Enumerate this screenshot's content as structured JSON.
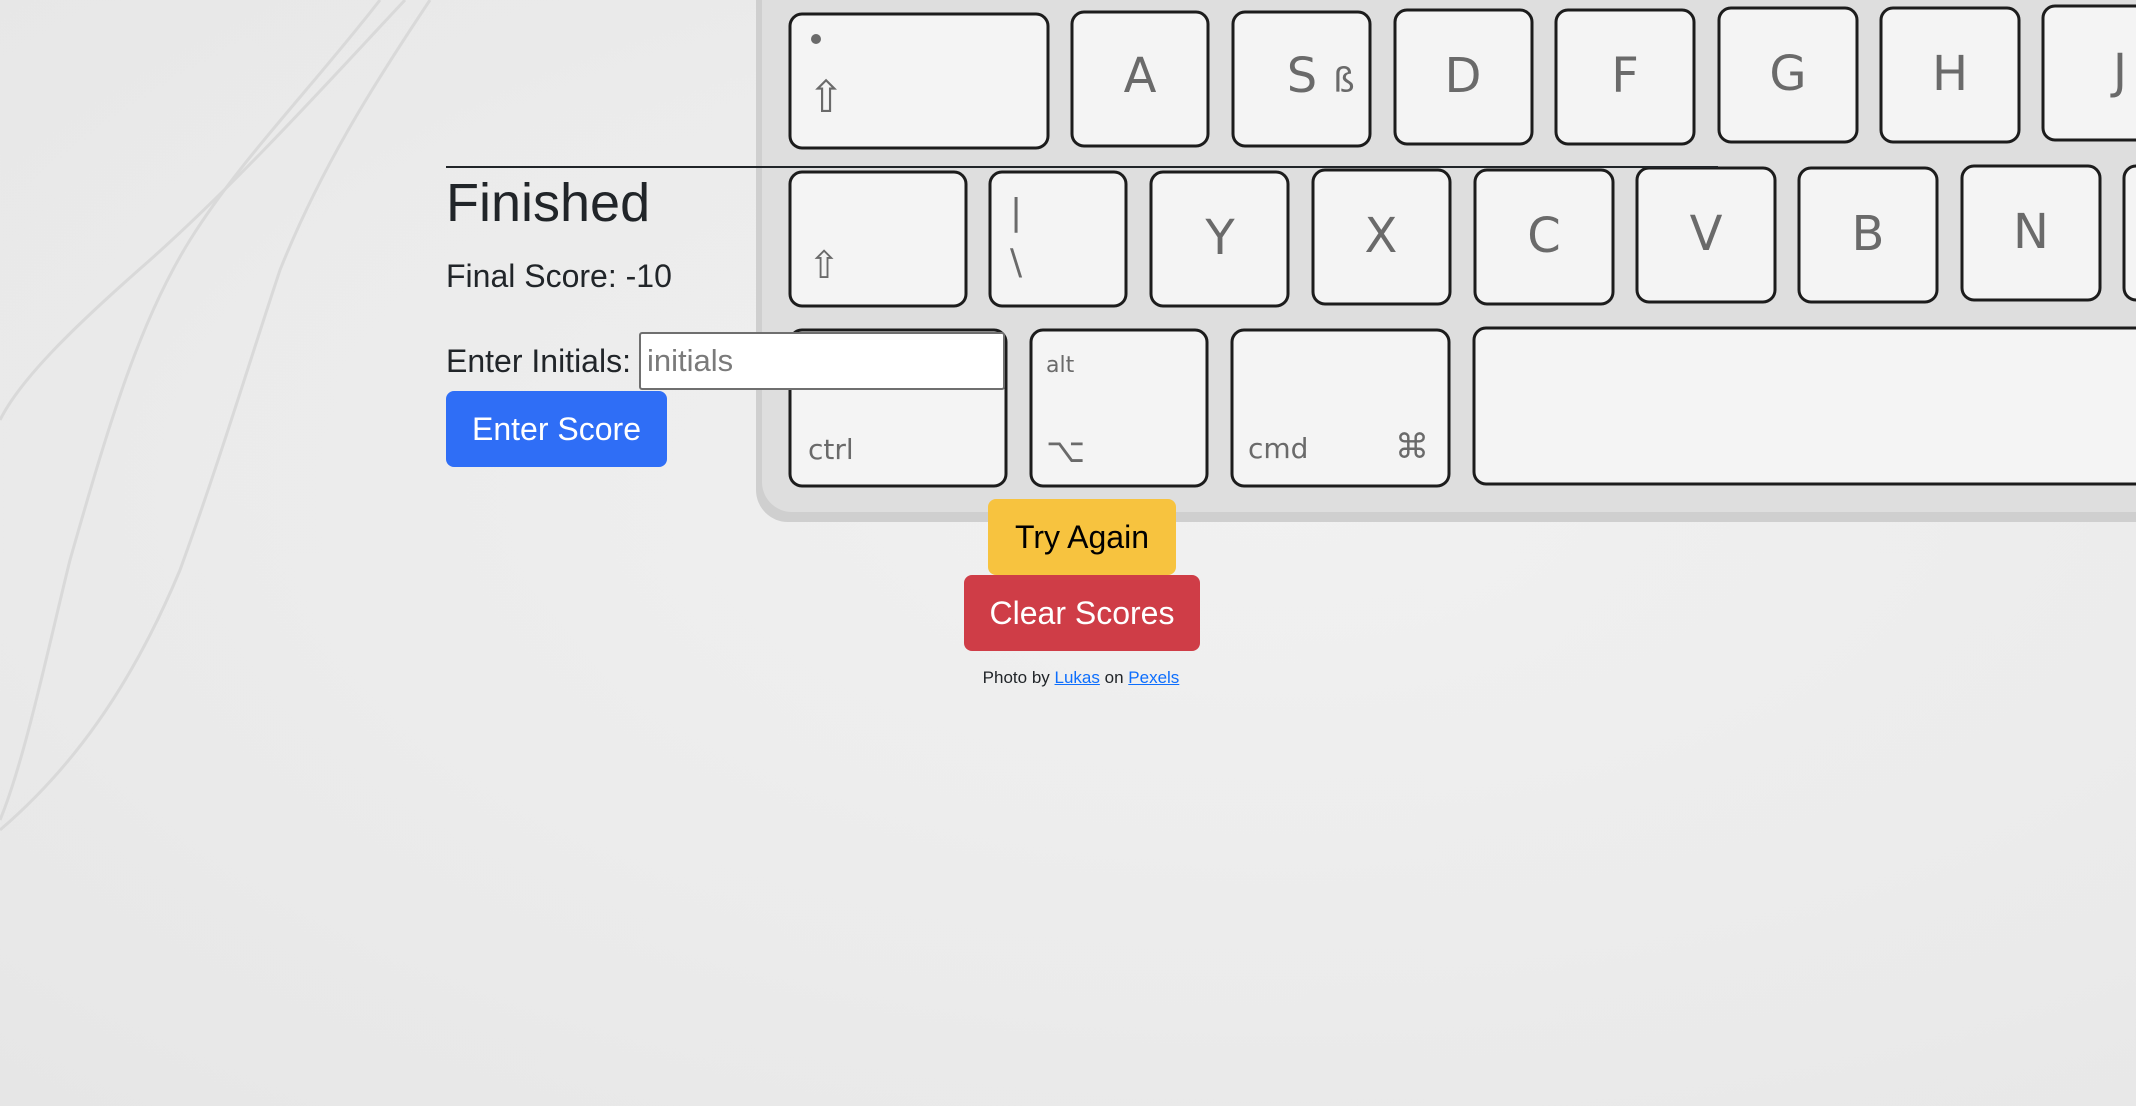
{
  "page": {
    "heading": "Finished",
    "final_score_label": "Final Score:",
    "final_score_value": "-10"
  },
  "form": {
    "initials_label": "Enter Initials:",
    "initials_placeholder": "initials",
    "initials_value": "",
    "submit_label": "Enter Score"
  },
  "actions": {
    "try_again_label": "Try Again",
    "clear_scores_label": "Clear Scores"
  },
  "credit": {
    "prefix": "Photo by",
    "author": "Lukas",
    "middle": "on",
    "site": "Pexels"
  },
  "background_keys": {
    "row1": [
      "A",
      "S",
      "ß",
      "D",
      "F",
      "G",
      "H",
      "J"
    ],
    "row2": [
      "|",
      "\\",
      "Y",
      "X",
      "C",
      "V",
      "B",
      "N"
    ],
    "row3": [
      "ctrl",
      "alt",
      "⌥",
      "cmd",
      "⌘"
    ],
    "shift_glyph": "⇧"
  },
  "colors": {
    "primary": "#2f6ef6",
    "warning": "#f7c33f",
    "danger": "#cf3d47",
    "link": "#0d6efd",
    "text": "#212529"
  },
  "icons": [
    "shift-icon",
    "option-icon",
    "command-icon"
  ]
}
